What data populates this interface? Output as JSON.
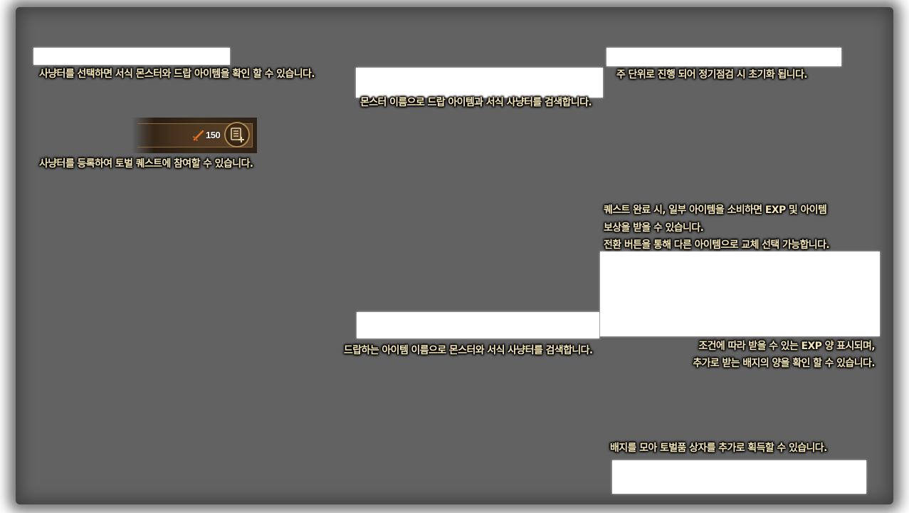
{
  "tips": {
    "select_hunter": "사냥터를 선택하면 서식 몬스터와 드랍 아이템을 확인 할 수 있습니다.",
    "register_hunter": "사냥터를 등록하여 토벌 퀘스트에 참여할 수 있습니다.",
    "monster_search": "몬스터 이름으로 드랍 아이템과 서식 사냥터를 검색합니다.",
    "item_search": "드랍하는 아이템 이름으로 몬스터와 서식 사냥터를 검색합니다.",
    "weekly_reset": "주 단위로 진행 되어 정기점검 시 초기화 됩니다.",
    "quest_reward_line1": "퀘스트 완료 시, 일부 아이템을 소비하면 EXP 및 아이템",
    "quest_reward_line2": "보상을 받을 수 있습니다.",
    "quest_reward_line3": "전환 버튼을 통해 다른 아이템으로 교체 선택 가능합니다.",
    "exp_badge_line1": "조건에 따라 받을 수 있는 EXP 양 표시되며,",
    "exp_badge_line2": "추가로 받는 배지의 양을 확인 할 수 있습니다.",
    "badge_box": "배지를 모아 토벌품 상자를 추가로 획득할 수 있습니다."
  },
  "hunter_slot": {
    "level": "150",
    "level_icon": "sword-icon",
    "add_icon": "register-list-icon"
  },
  "colors": {
    "overlay": "#626262",
    "tip_text": "#f5e6b8",
    "accent": "#b08a4c"
  }
}
